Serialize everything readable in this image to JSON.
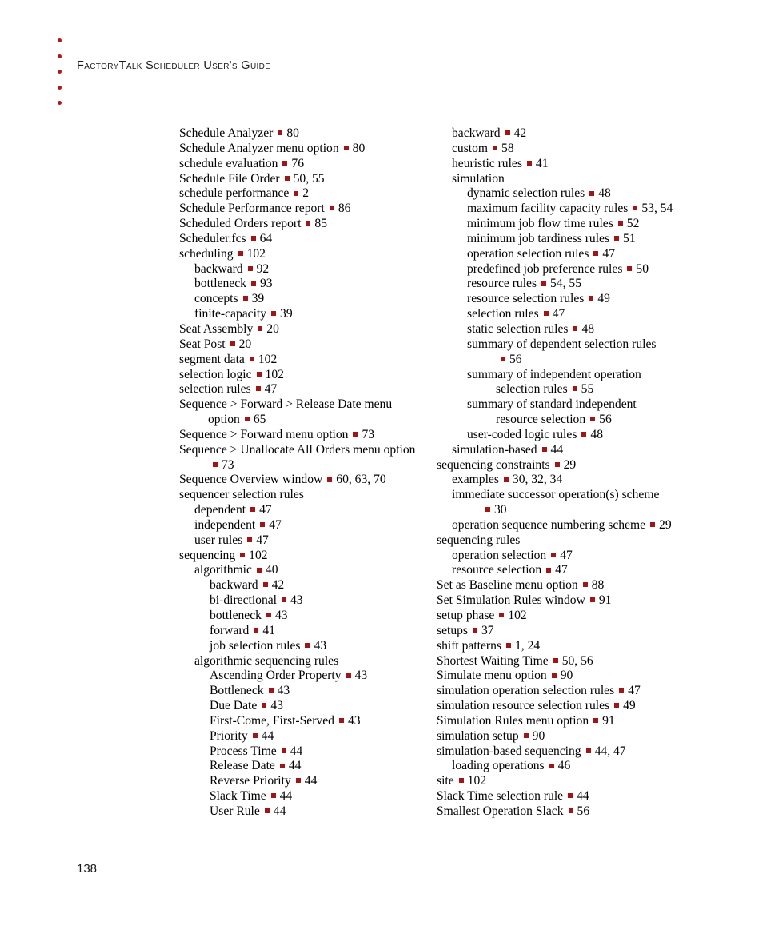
{
  "header": {
    "title": "FactoryTalk Scheduler User's Guide",
    "dot_count": 5,
    "dot_color": "#B01818"
  },
  "folio": {
    "page_number": "138"
  },
  "style": {
    "separator_color": "#A01616",
    "text_color": "#000000"
  },
  "index": {
    "columns": [
      {
        "name": "left",
        "entries": [
          {
            "level": 0,
            "text": "Schedule Analyzer",
            "pages": "80"
          },
          {
            "level": 0,
            "text": "Schedule Analyzer menu option",
            "pages": "80"
          },
          {
            "level": 0,
            "text": "schedule evaluation",
            "pages": "76"
          },
          {
            "level": 0,
            "text": "Schedule File Order",
            "pages": "50, 55"
          },
          {
            "level": 0,
            "text": "schedule performance",
            "pages": "2"
          },
          {
            "level": 0,
            "text": "Schedule Performance report",
            "pages": "86"
          },
          {
            "level": 0,
            "text": "Scheduled Orders report",
            "pages": "85"
          },
          {
            "level": 0,
            "text": "Scheduler.fcs",
            "pages": "64"
          },
          {
            "level": 0,
            "text": "scheduling",
            "pages": "102"
          },
          {
            "level": 1,
            "text": "backward",
            "pages": "92"
          },
          {
            "level": 1,
            "text": "bottleneck",
            "pages": "93"
          },
          {
            "level": 1,
            "text": "concepts",
            "pages": "39"
          },
          {
            "level": 1,
            "text": "finite-capacity",
            "pages": "39"
          },
          {
            "level": 0,
            "text": "Seat Assembly",
            "pages": "20"
          },
          {
            "level": 0,
            "text": "Seat Post",
            "pages": "20"
          },
          {
            "level": 0,
            "text": "segment data",
            "pages": "102"
          },
          {
            "level": 0,
            "text": "selection logic",
            "pages": "102"
          },
          {
            "level": 0,
            "text": "selection rules",
            "pages": "47"
          },
          {
            "level": 0,
            "text": "Sequence > Forward > Release Date menu",
            "cont": "option",
            "pages": "65"
          },
          {
            "level": 0,
            "text": "Sequence > Forward menu option",
            "pages": "73"
          },
          {
            "level": 0,
            "text": "Sequence > Unallocate All Orders menu option",
            "cont": "",
            "pages": "73"
          },
          {
            "level": 0,
            "text": "Sequence Overview window",
            "pages": "60, 63, 70"
          },
          {
            "level": 0,
            "text": "sequencer selection rules",
            "pages": ""
          },
          {
            "level": 1,
            "text": "dependent",
            "pages": "47"
          },
          {
            "level": 1,
            "text": "independent",
            "pages": "47"
          },
          {
            "level": 1,
            "text": "user rules",
            "pages": "47"
          },
          {
            "level": 0,
            "text": "sequencing",
            "pages": "102"
          },
          {
            "level": 1,
            "text": "algorithmic",
            "pages": "40"
          },
          {
            "level": 2,
            "text": "backward",
            "pages": "42"
          },
          {
            "level": 2,
            "text": "bi-directional",
            "pages": "43"
          },
          {
            "level": 2,
            "text": "bottleneck",
            "pages": "43"
          },
          {
            "level": 2,
            "text": "forward",
            "pages": "41"
          },
          {
            "level": 2,
            "text": "job selection rules",
            "pages": "43"
          },
          {
            "level": 1,
            "text": "algorithmic sequencing rules",
            "pages": ""
          },
          {
            "level": 2,
            "text": "Ascending Order Property",
            "pages": "43"
          },
          {
            "level": 2,
            "text": "Bottleneck",
            "pages": "43"
          },
          {
            "level": 2,
            "text": "Due Date",
            "pages": "43"
          },
          {
            "level": 2,
            "text": "First-Come, First-Served",
            "pages": "43"
          },
          {
            "level": 2,
            "text": "Priority",
            "pages": "44"
          },
          {
            "level": 2,
            "text": "Process Time",
            "pages": "44"
          },
          {
            "level": 2,
            "text": "Release Date",
            "pages": "44"
          },
          {
            "level": 2,
            "text": "Reverse Priority",
            "pages": "44"
          },
          {
            "level": 2,
            "text": "Slack Time",
            "pages": "44"
          },
          {
            "level": 2,
            "text": "User Rule",
            "pages": "44"
          }
        ]
      },
      {
        "name": "right",
        "entries": [
          {
            "level": 1,
            "text": "backward",
            "pages": "42"
          },
          {
            "level": 1,
            "text": "custom",
            "pages": "58"
          },
          {
            "level": 1,
            "text": "heuristic rules",
            "pages": "41"
          },
          {
            "level": 1,
            "text": "simulation",
            "pages": ""
          },
          {
            "level": 2,
            "text": "dynamic selection rules",
            "pages": "48"
          },
          {
            "level": 2,
            "text": "maximum facility capacity rules",
            "pages": "53, 54"
          },
          {
            "level": 2,
            "text": "minimum job flow time rules",
            "pages": "52"
          },
          {
            "level": 2,
            "text": "minimum job tardiness rules",
            "pages": "51"
          },
          {
            "level": 2,
            "text": "operation selection rules",
            "pages": "47"
          },
          {
            "level": 2,
            "text": "predefined job preference rules",
            "pages": "50"
          },
          {
            "level": 2,
            "text": "resource rules",
            "pages": "54, 55"
          },
          {
            "level": 2,
            "text": "resource selection rules",
            "pages": "49"
          },
          {
            "level": 2,
            "text": "selection rules",
            "pages": "47"
          },
          {
            "level": 2,
            "text": "static selection rules",
            "pages": "48"
          },
          {
            "level": 2,
            "text": "summary of dependent selection rules",
            "cont": "",
            "pages": "56"
          },
          {
            "level": 2,
            "text": "summary of independent operation",
            "cont": "selection rules",
            "pages": "55"
          },
          {
            "level": 2,
            "text": "summary of standard independent",
            "cont": "resource selection",
            "pages": "56"
          },
          {
            "level": 2,
            "text": "user-coded logic rules",
            "pages": "48"
          },
          {
            "level": 1,
            "text": "simulation-based",
            "pages": "44"
          },
          {
            "level": 0,
            "text": "sequencing constraints",
            "pages": "29"
          },
          {
            "level": 1,
            "text": "examples",
            "pages": "30, 32, 34"
          },
          {
            "level": 1,
            "text": "immediate successor operation(s) scheme",
            "cont": "",
            "pages": "30"
          },
          {
            "level": 1,
            "text": "operation sequence numbering scheme",
            "pages": "29"
          },
          {
            "level": 0,
            "text": "sequencing rules",
            "pages": ""
          },
          {
            "level": 1,
            "text": "operation selection",
            "pages": "47"
          },
          {
            "level": 1,
            "text": "resource selection",
            "pages": "47"
          },
          {
            "level": 0,
            "text": "Set as Baseline menu option",
            "pages": "88"
          },
          {
            "level": 0,
            "text": "Set Simulation Rules window",
            "pages": "91"
          },
          {
            "level": 0,
            "text": "setup phase",
            "pages": "102"
          },
          {
            "level": 0,
            "text": "setups",
            "pages": "37"
          },
          {
            "level": 0,
            "text": "shift patterns",
            "pages": "1, 24"
          },
          {
            "level": 0,
            "text": "Shortest Waiting Time",
            "pages": "50, 56"
          },
          {
            "level": 0,
            "text": "Simulate menu option",
            "pages": "90"
          },
          {
            "level": 0,
            "text": "simulation operation selection rules",
            "pages": "47"
          },
          {
            "level": 0,
            "text": "simulation resource selection rules",
            "pages": "49"
          },
          {
            "level": 0,
            "text": "Simulation Rules menu option",
            "pages": "91"
          },
          {
            "level": 0,
            "text": "simulation setup",
            "pages": "90"
          },
          {
            "level": 0,
            "text": "simulation-based sequencing",
            "pages": "44, 47"
          },
          {
            "level": 1,
            "text": "loading operations",
            "pages": "46"
          },
          {
            "level": 0,
            "text": "site",
            "pages": "102"
          },
          {
            "level": 0,
            "text": "Slack Time selection rule",
            "pages": "44"
          },
          {
            "level": 0,
            "text": "Smallest Operation Slack",
            "pages": "56"
          }
        ]
      }
    ]
  }
}
